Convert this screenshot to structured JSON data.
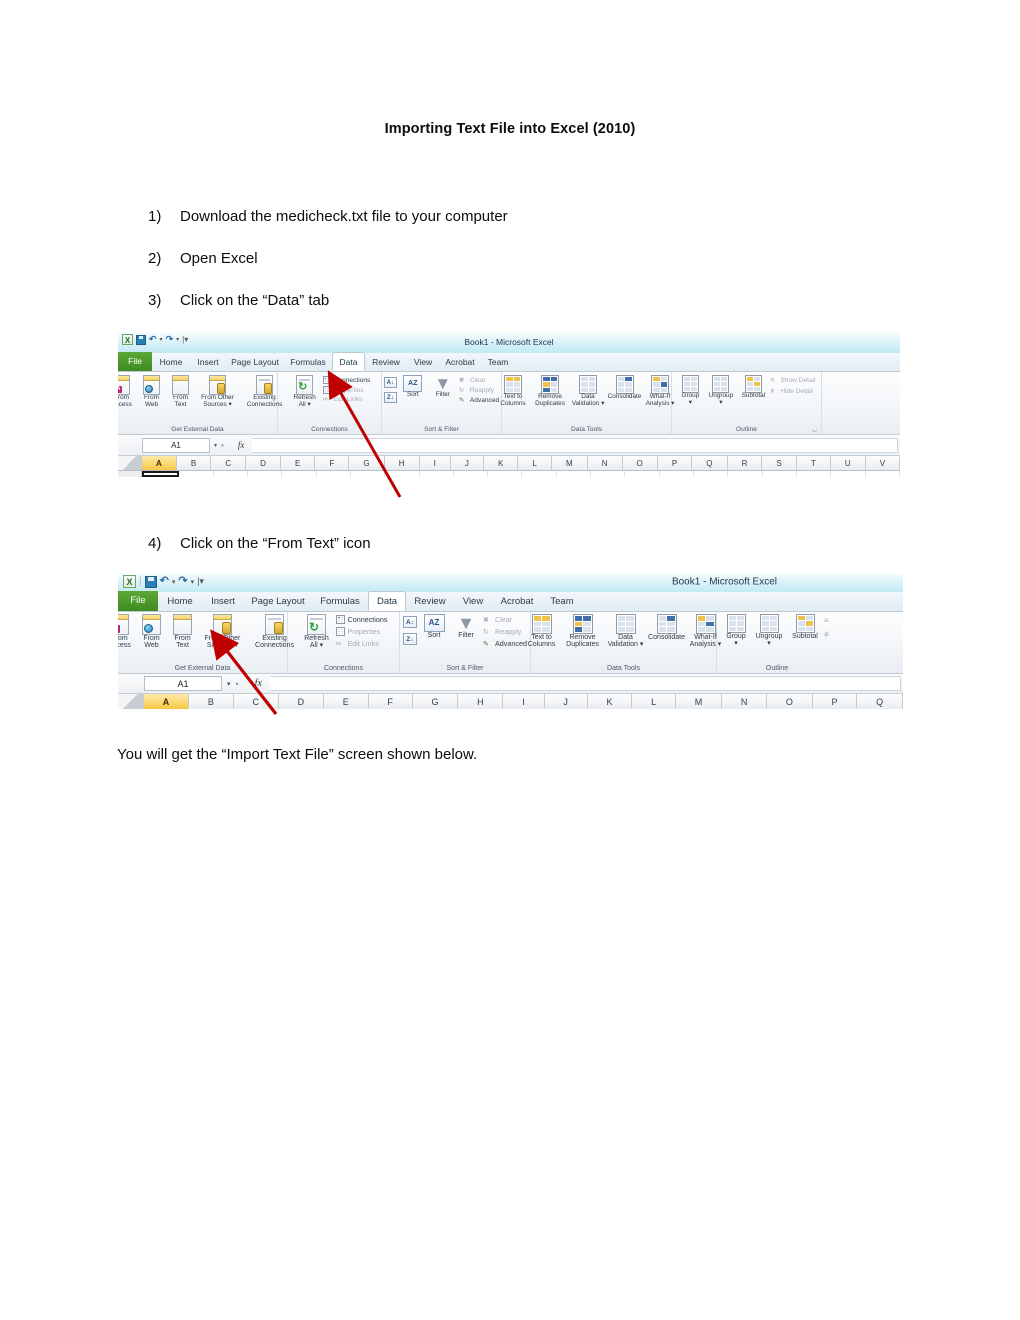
{
  "document": {
    "title": "Importing Text File into Excel (2010)",
    "steps": [
      {
        "num": "1)",
        "text": "Download the medicheck.txt file to your computer"
      },
      {
        "num": "2)",
        "text": "Open Excel"
      },
      {
        "num": "3)",
        "text": "Click on the “Data” tab"
      },
      {
        "num": "4)",
        "text": "Click on the “From Text” icon"
      }
    ],
    "closing_paragraph": "You will get the “Import Text File” screen shown below."
  },
  "screenshot_one": {
    "window_title": "Book1  -  Microsoft Excel",
    "quick_access": {
      "app_logo": "excel-logo",
      "save": "save-icon",
      "undo": "undo-icon",
      "redo": "redo-icon",
      "customize": "customize-qat-icon"
    },
    "tabs": [
      "File",
      "Home",
      "Insert",
      "Page Layout",
      "Formulas",
      "Data",
      "Review",
      "View",
      "Acrobat",
      "Team"
    ],
    "active_tab": "Data",
    "ribbon_groups": [
      {
        "label": "Get External Data",
        "buttons": [
          "From\nAccess",
          "From\nWeb",
          "From\nText",
          "From Other\nSources ▾",
          "Existing\nConnections"
        ]
      },
      {
        "label": "Connections",
        "big": [
          "Refresh\nAll ▾"
        ],
        "small": [
          "Connections",
          "Properties",
          "Edit Links"
        ]
      },
      {
        "label": "Sort & Filter",
        "big": [
          "Sort",
          "Filter"
        ],
        "small": [
          "Clear",
          "Reapply",
          "Advanced"
        ]
      },
      {
        "label": "Data Tools",
        "buttons": [
          "Text to\nColumns",
          "Remove\nDuplicates",
          "Data\nValidation ▾",
          "Consolidate",
          "What-If\nAnalysis ▾"
        ]
      },
      {
        "label": "Outline",
        "big": [
          "Group\n▾",
          "Ungroup\n▾",
          "Subtotal"
        ],
        "small": [
          "Show Detail",
          "Hide Detail"
        ]
      }
    ],
    "name_box": "A1",
    "formula_bar_value": "",
    "fx_label": "fx",
    "columns": [
      "A",
      "B",
      "C",
      "D",
      "E",
      "F",
      "G",
      "H",
      "I",
      "J",
      "K",
      "L",
      "M",
      "N",
      "O",
      "P",
      "Q",
      "R",
      "S",
      "T",
      "U",
      "V"
    ],
    "selected_column": "A",
    "annotation": "red-arrow-pointing-to-data-tab"
  },
  "screenshot_two": {
    "window_title": "Book1  -  Microsoft Excel",
    "quick_access": {
      "app_logo": "excel-logo",
      "save": "save-icon",
      "undo": "undo-icon",
      "redo": "redo-icon",
      "customize": "customize-qat-icon"
    },
    "tabs": [
      "File",
      "Home",
      "Insert",
      "Page Layout",
      "Formulas",
      "Data",
      "Review",
      "View",
      "Acrobat",
      "Team"
    ],
    "active_tab": "Data",
    "ribbon_groups": [
      {
        "label": "Get External Data",
        "buttons": [
          "From\nAccess",
          "From\nWeb",
          "From\nText",
          "From Other\nSources ▾",
          "Existing\nConnections"
        ]
      },
      {
        "label": "Connections",
        "big": [
          "Refresh\nAll ▾"
        ],
        "small": [
          "Connections",
          "Properties",
          "Edit Links"
        ]
      },
      {
        "label": "Sort & Filter",
        "big": [
          "Sort",
          "Filter"
        ],
        "small": [
          "Clear",
          "Reapply",
          "Advanced"
        ]
      },
      {
        "label": "Data Tools",
        "buttons": [
          "Text to\nColumns",
          "Remove\nDuplicates",
          "Data\nValidation ▾",
          "Consolidate",
          "What-If\nAnalysis ▾"
        ]
      },
      {
        "label": "Outline",
        "big": [
          "Group\n▾",
          "Ungroup\n▾",
          "Subtotal"
        ],
        "small": [
          "",
          ""
        ]
      }
    ],
    "name_box": "A1",
    "formula_bar_value": "",
    "fx_label": "fx",
    "columns": [
      "A",
      "B",
      "C",
      "D",
      "E",
      "F",
      "G",
      "H",
      "I",
      "J",
      "K",
      "L",
      "M",
      "N",
      "O",
      "P",
      "Q"
    ],
    "selected_column": "A",
    "annotation": "red-arrow-pointing-to-from-text-icon"
  },
  "colors": {
    "accent_red": "#c00000",
    "file_tab_green": "#4d9a2a",
    "selected_header": "#f6c944",
    "titlebar_cyan": "#c3e9f3"
  }
}
